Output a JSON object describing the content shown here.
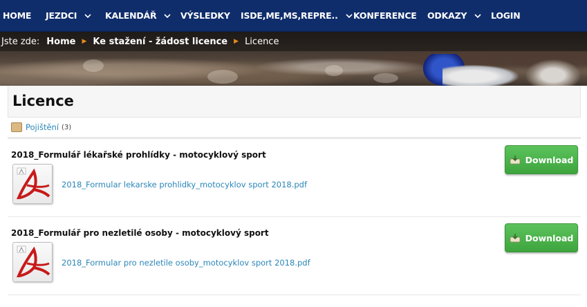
{
  "nav": {
    "items": [
      {
        "label": "HOME",
        "dropdown": false
      },
      {
        "label": "JEZDCI",
        "dropdown": true
      },
      {
        "label": "KALENDÁŘ",
        "dropdown": true
      },
      {
        "label": "VÝSLEDKY",
        "dropdown": false
      },
      {
        "label": "ISDE,ME,MS,REPRE..",
        "dropdown": true
      },
      {
        "label": "KONFERENCE",
        "dropdown": false
      },
      {
        "label": "ODKAZY",
        "dropdown": true
      },
      {
        "label": "LOGIN",
        "dropdown": false
      }
    ]
  },
  "breadcrumb": {
    "prefix": "Jste zde:",
    "links": [
      "Home",
      "Ke stažení - žádost licence"
    ],
    "current": "Licence"
  },
  "page": {
    "title": "Licence"
  },
  "category": {
    "label": "Pojištění",
    "count": "(3)"
  },
  "documents": [
    {
      "title": "2018_Formulář lékařské prohlídky - motocyklový sport",
      "file": "2018_Formular lekarske prohlidky_motocyklov sport 2018.pdf",
      "button": "Download"
    },
    {
      "title": "2018_Formulář pro nezletilé osoby - motocyklový sport",
      "file": "2018_Formular pro nezletile osoby_motocyklov sport 2018.pdf",
      "button": "Download"
    }
  ],
  "colors": {
    "nav_bg": "#0f2d6b",
    "link": "#2a86b8",
    "download_button": "#4cb34c",
    "breadcrumb_separator": "#e88a1a"
  },
  "icons": {
    "nav_dropdown": "chevron-down-icon",
    "category": "folder-icon",
    "document": "pdf-file-icon",
    "download": "download-icon"
  }
}
